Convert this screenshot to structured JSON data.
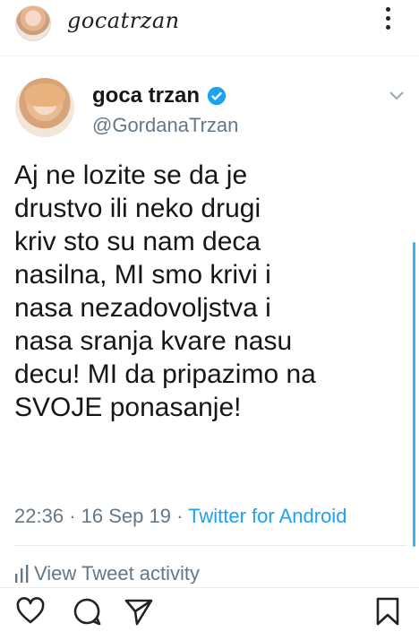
{
  "post_header": {
    "handle": "gocatrzan",
    "more_icon": "more-vertical-icon"
  },
  "tweet": {
    "display_name": "goca trzan",
    "verified_icon": "verified-badge-icon",
    "username": "@GordanaTrzan",
    "menu_icon": "chevron-down-icon",
    "text": "Aj ne lozite se da je\ndrustvo ili neko drugi\nkriv sto su nam deca\nnasilna, MI smo krivi i\nnasa nezadovoljstva i\nnasa sranja kvare nasu\ndecu! MI da pripazimo na\nSVOJE ponasanje!",
    "time": "22:36",
    "date": "16 Sep 19",
    "source": "Twitter for Android",
    "activity_label": "View Tweet activity",
    "activity_icon": "bar-chart-icon",
    "accent_color": "#1da1f2"
  },
  "actions": {
    "like_icon": "heart-icon",
    "comment_icon": "comment-icon",
    "share_icon": "send-icon",
    "save_icon": "bookmark-icon"
  }
}
